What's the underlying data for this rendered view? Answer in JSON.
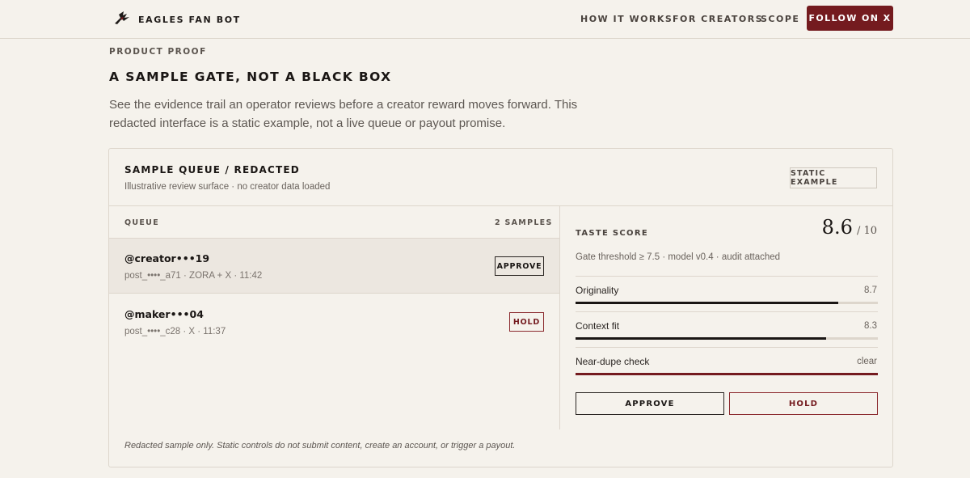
{
  "header": {
    "brand_name": "EAGLES FAN BOT",
    "logo_icon": "eagle-logo-icon",
    "nav": [
      "HOW IT WORKS",
      "FOR CREATORS",
      "SCOPE"
    ],
    "cta_label": "FOLLOW ON X"
  },
  "intro": {
    "eyebrow": "PRODUCT PROOF",
    "title": "A SAMPLE GATE, NOT A BLACK BOX",
    "lede": "See the evidence trail an operator reviews before a creator reward moves forward. This redacted interface is a static example, not a live queue or payout promise."
  },
  "card": {
    "title": "SAMPLE QUEUE / REDACTED",
    "subtitle": "Illustrative review surface · no creator data loaded",
    "badge": "STATIC EXAMPLE",
    "footnote": "Redacted sample only. Static controls do not submit content, create an account, or trigger a payout."
  },
  "queue": {
    "header": "QUEUE",
    "count": "2 SAMPLES",
    "items": [
      {
        "handle": "@creator•••19",
        "meta": "post_••••_a71 · ZORA + X · 11:42",
        "status": "APPROVE"
      },
      {
        "handle": "@maker•••04",
        "meta": "post_••••_c28 · X · 11:37",
        "status": "HOLD"
      }
    ]
  },
  "review": {
    "label": "TASTE SCORE",
    "score": "8.6",
    "score_max": "/ 10",
    "gate": "Gate threshold ≥ 7.5 · model v0.4 · audit attached",
    "metrics": [
      {
        "label": "Originality",
        "value": "8.7",
        "level": 0.87
      },
      {
        "label": "Context fit",
        "value": "8.3",
        "level": 0.83
      },
      {
        "label": "Near-dupe check",
        "value": "clear",
        "level": 1.0
      }
    ],
    "approve_label": "APPROVE",
    "hold_label": "HOLD"
  },
  "colors": {
    "accent": "#741b1f",
    "background": "#f5f2ec",
    "border": "#ddd6cc",
    "selected_row": "#ece7e0"
  }
}
